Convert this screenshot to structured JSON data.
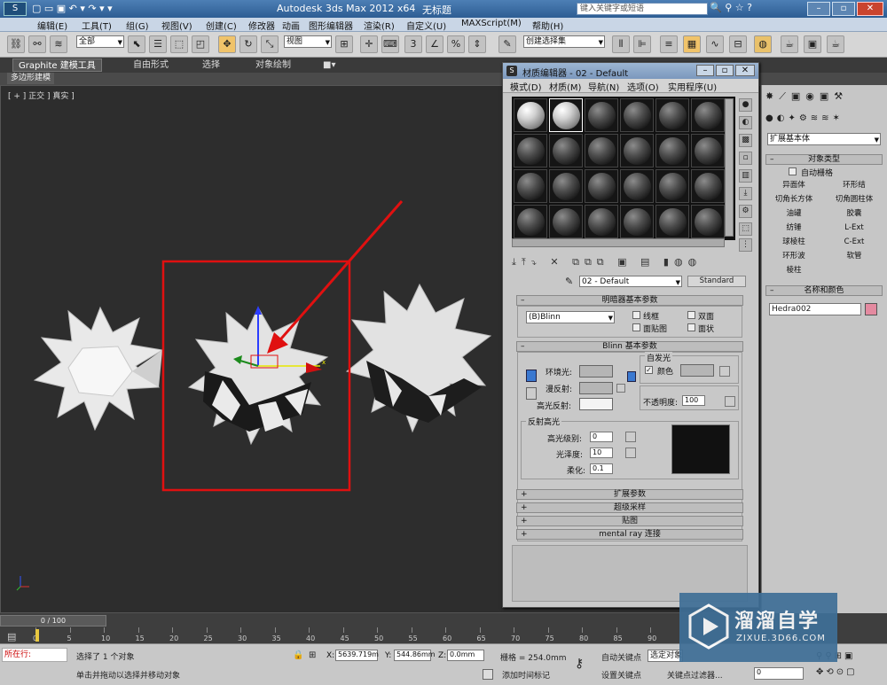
{
  "titlebar": {
    "app_title": "Autodesk 3ds Max  2012 x64",
    "file_title": "无标题",
    "search_placeholder": "键入关键字或短语"
  },
  "menu": [
    "编辑(E)",
    "工具(T)",
    "组(G)",
    "视图(V)",
    "创建(C)",
    "修改器",
    "动画",
    "图形编辑器",
    "渲染(R)",
    "自定义(U)",
    "MAXScript(M)",
    "帮助(H)"
  ],
  "toolbar": {
    "selection_filter": "全部",
    "ref_coord": "视图",
    "named_selection": "创建选择集"
  },
  "ribbon": {
    "tabs": [
      "Graphite 建模工具",
      "自由形式",
      "选择",
      "对象绘制"
    ],
    "sub_label": "多边形建模"
  },
  "viewport": {
    "label": "[ + ] 正交 ] 真实 ]"
  },
  "material_editor": {
    "title": "材质编辑器 - 02 - Default",
    "menu": [
      "模式(D)",
      "材质(M)",
      "导航(N)",
      "选项(O)",
      "实用程序(U)"
    ],
    "material_name": "02 - Default",
    "material_type": "Standard",
    "shader_rollout": "明暗器基本参数",
    "shader": "(B)Blinn",
    "shader_opts": [
      "线框",
      "双面",
      "面贴图",
      "面状"
    ],
    "blinn_rollout": "Blinn 基本参数",
    "self_illum": "自发光",
    "color_label": "颜色",
    "ambient": "环境光:",
    "diffuse": "漫反射:",
    "specular": "高光反射:",
    "opacity_label": "不透明度:",
    "opacity_value": "100",
    "spec_hl": "反射高光",
    "spec_level_label": "高光级别:",
    "spec_level": "0",
    "gloss_label": "光泽度:",
    "gloss": "10",
    "soften_label": "柔化:",
    "soften": "0.1",
    "rollouts": [
      "扩展参数",
      "超级采样",
      "贴图",
      "mental ray 连接"
    ]
  },
  "command_panel": {
    "dropdown": "扩展基本体",
    "object_type": "对象类型",
    "auto_grid": "自动栅格",
    "buttons": [
      "异面体",
      "环形结",
      "切角长方体",
      "切角圆柱体",
      "油罐",
      "胶囊",
      "纺锤",
      "L-Ext",
      "球棱柱",
      "C-Ext",
      "环形波",
      "软管",
      "棱柱"
    ],
    "name_color": "名称和颜色",
    "object_name": "Hedra002"
  },
  "timeline": {
    "frame": "0 / 100",
    "ticks": [
      "0",
      "5",
      "10",
      "15",
      "20",
      "25",
      "30",
      "35",
      "40",
      "45",
      "50",
      "55",
      "60",
      "65",
      "70",
      "75",
      "80",
      "85",
      "90"
    ]
  },
  "status": {
    "running": "所在行:",
    "selected": "选择了 1 个对象",
    "prompt": "单击并拖动以选择并移动对象",
    "x_label": "X:",
    "x": "5639.719m",
    "y_label": "Y:",
    "y": "544.86mm",
    "z_label": "Z:",
    "z": "0.0mm",
    "grid": "栅格 = 254.0mm",
    "add_time_tag": "添加时间标记",
    "auto_key": "自动关键点",
    "selected_obj": "选定对象",
    "set_key": "设置关键点",
    "key_filter": "关键点过滤器...",
    "frame_field": "0"
  },
  "watermark": {
    "name": "溜溜自学",
    "url": "ZIXUE.3D66.COM"
  },
  "colors": {
    "selection_box": "#e01010",
    "arrow": "#e01010",
    "object_color": "#e48aa0"
  }
}
